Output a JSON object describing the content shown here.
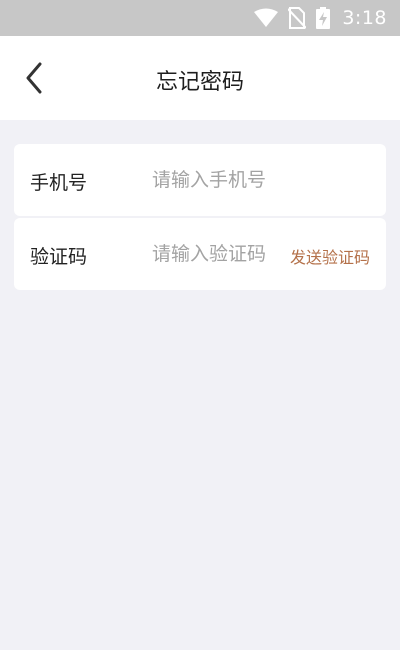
{
  "status_bar": {
    "time": "3:18",
    "icons": [
      "wifi-icon",
      "no-sim-icon",
      "battery-charging-icon"
    ]
  },
  "header": {
    "back_icon": "chevron-left-icon",
    "title": "忘记密码"
  },
  "form": {
    "phone": {
      "label": "手机号",
      "placeholder": "请输入手机号",
      "value": ""
    },
    "code": {
      "label": "验证码",
      "placeholder": "请输入验证码",
      "value": "",
      "send_label": "发送验证码"
    }
  },
  "colors": {
    "status_bar": "#c7c7c7",
    "background": "#f1f1f6",
    "card": "#ffffff",
    "accent": "#b4714a",
    "placeholder": "#a3a3a3"
  }
}
